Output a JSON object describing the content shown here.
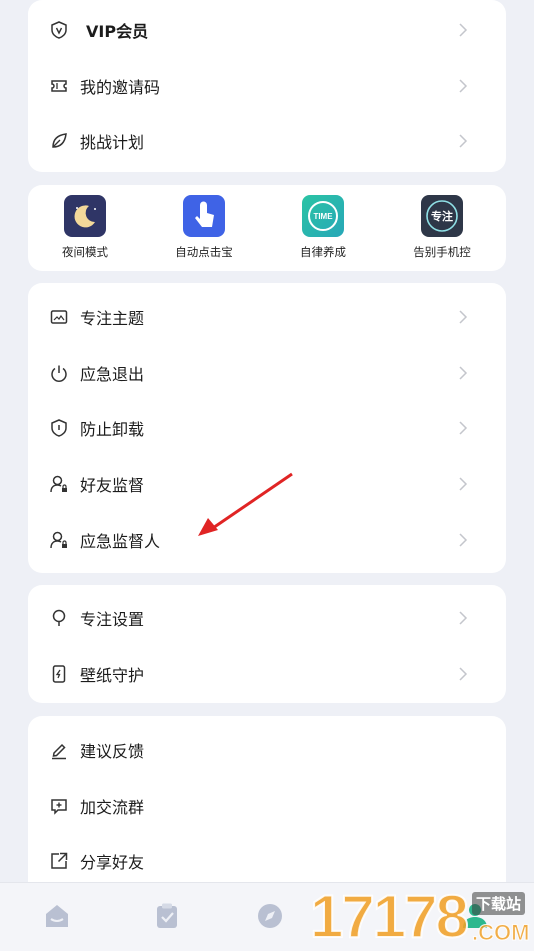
{
  "account_menu": {
    "items": [
      {
        "label": "VIP会员",
        "icon": "vip-shield-icon"
      },
      {
        "label": "我的邀请码",
        "icon": "ticket-icon"
      },
      {
        "label": "挑战计划",
        "icon": "leaf-icon"
      }
    ]
  },
  "tools": {
    "items": [
      {
        "label": "夜间模式",
        "icon": "moon-icon"
      },
      {
        "label": "自动点击宝",
        "icon": "tap-hand-icon"
      },
      {
        "label": "自律养成",
        "icon": "time-icon",
        "badge": "TIME"
      },
      {
        "label": "告别手机控",
        "icon": "focus-icon",
        "badge": "专注"
      }
    ]
  },
  "focus_menu": {
    "items": [
      {
        "label": "专注主题",
        "icon": "image-icon"
      },
      {
        "label": "应急退出",
        "icon": "power-icon"
      },
      {
        "label": "防止卸载",
        "icon": "shield-icon"
      },
      {
        "label": "好友监督",
        "icon": "user-lock-icon"
      },
      {
        "label": "应急监督人",
        "icon": "user-lock-icon"
      }
    ]
  },
  "settings_menu": {
    "items": [
      {
        "label": "专注设置",
        "icon": "bulb-icon"
      },
      {
        "label": "壁纸守护",
        "icon": "phone-bolt-icon"
      }
    ]
  },
  "social_menu": {
    "items": [
      {
        "label": "建议反馈",
        "icon": "pencil-icon"
      },
      {
        "label": "加交流群",
        "icon": "chat-plus-icon"
      },
      {
        "label": "分享好友",
        "icon": "share-icon"
      }
    ]
  },
  "tabbar": {
    "tabs": [
      {
        "name": "home-tab",
        "icon": "home-icon"
      },
      {
        "name": "tasks-tab",
        "icon": "clipboard-icon"
      },
      {
        "name": "discover-tab",
        "icon": "compass-icon"
      },
      {
        "name": "profile-tab",
        "icon": "person-icon"
      }
    ]
  },
  "watermark": {
    "text": "17178",
    "site": "下载站",
    "suffix": ".COM"
  },
  "colors": {
    "accent_red": "#e02424",
    "card": "#ffffff",
    "background": "#eef0f6"
  }
}
